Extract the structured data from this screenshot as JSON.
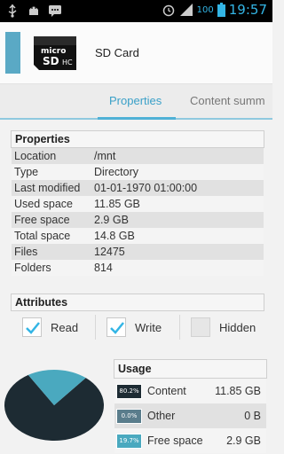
{
  "status_bar": {
    "battery_percent": "100",
    "time": "19:57",
    "icons": [
      "usb-icon",
      "android-debug-icon",
      "message-icon",
      "alarm-icon",
      "signal-icon",
      "battery-icon"
    ]
  },
  "header": {
    "title": "SD Card",
    "accent_color": "#5aa9c5"
  },
  "tabs": [
    {
      "label": "Properties",
      "active": true
    },
    {
      "label": "Content summ",
      "active": false
    }
  ],
  "properties": {
    "heading": "Properties",
    "rows": [
      {
        "key": "Location",
        "value": "/mnt"
      },
      {
        "key": "Type",
        "value": "Directory"
      },
      {
        "key": "Last modified",
        "value": "01-01-1970 01:00:00"
      },
      {
        "key": "Used space",
        "value": "11.85 GB"
      },
      {
        "key": "Free space",
        "value": "2.9 GB"
      },
      {
        "key": "Total space",
        "value": "14.8 GB"
      },
      {
        "key": "Files",
        "value": "12475"
      },
      {
        "key": "Folders",
        "value": "814"
      }
    ]
  },
  "attributes": {
    "heading": "Attributes",
    "items": [
      {
        "label": "Read",
        "checked": true
      },
      {
        "label": "Write",
        "checked": true
      },
      {
        "label": "Hidden",
        "checked": false
      }
    ]
  },
  "usage": {
    "heading": "Usage",
    "rows": [
      {
        "percent_label": "80.2%",
        "name": "Content",
        "value": "11.85 GB",
        "color": "#1d2b33"
      },
      {
        "percent_label": "0.0%",
        "name": "Other",
        "value": "0 B",
        "color": "#5a7d8c"
      },
      {
        "percent_label": "19.7%",
        "name": "Free space",
        "value": "2.9 GB",
        "color": "#4aa9bf"
      }
    ]
  },
  "chart_data": {
    "type": "pie",
    "categories": [
      "Content",
      "Other",
      "Free space"
    ],
    "values": [
      80.2,
      0.0,
      19.7
    ],
    "colors": [
      "#1d2b33",
      "#5a7d8c",
      "#4aa9bf"
    ]
  }
}
